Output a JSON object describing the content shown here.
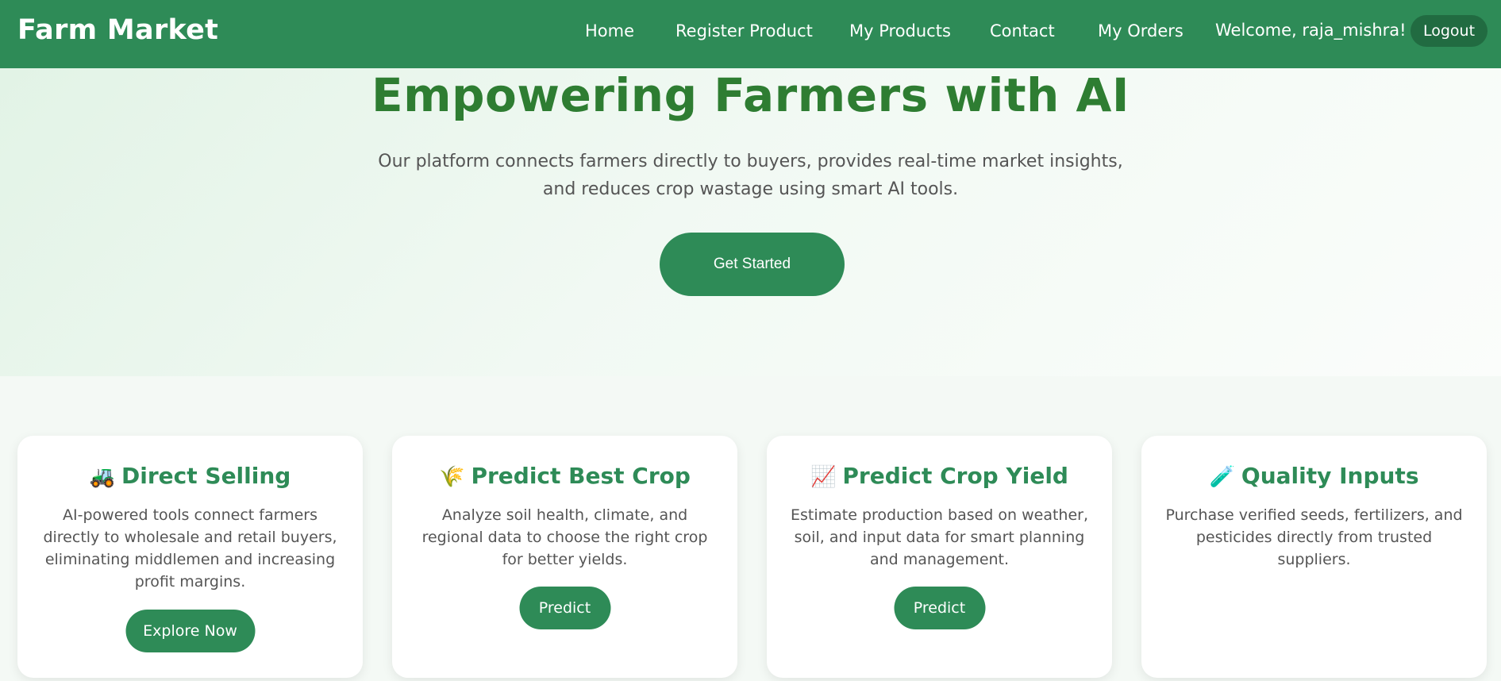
{
  "header": {
    "brand": "Farm Market",
    "nav": [
      "Home",
      "Register Product",
      "My Products",
      "Contact",
      "My Orders"
    ],
    "welcome": "Welcome, raja_mishra!",
    "logout": "Logout"
  },
  "hero": {
    "title": "Empowering Farmers with AI",
    "subtitle_line1": "Our platform connects farmers directly to buyers, provides real-time market insights,",
    "subtitle_line2": "and reduces crop wastage using smart AI tools.",
    "cta": "Get Started"
  },
  "features": [
    {
      "icon": "tractor-icon",
      "emoji": "🚜",
      "title": "Direct Selling",
      "description": "AI-powered tools connect farmers directly to wholesale and retail buyers, eliminating middlemen and increasing profit margins.",
      "button": "Explore Now"
    },
    {
      "icon": "wheat-icon",
      "emoji": "🌾",
      "title": "Predict Best Crop",
      "description": "Analyze soil health, climate, and regional data to choose the right crop for better yields.",
      "button": "Predict"
    },
    {
      "icon": "chart-increasing-icon",
      "emoji": "📈",
      "title": "Predict Crop Yield",
      "description": "Estimate production based on weather, soil, and input data for smart planning and management.",
      "button": "Predict"
    },
    {
      "icon": "test-tube-icon",
      "emoji": "🧪",
      "title": "Quality Inputs",
      "description": "Purchase verified seeds, fertilizers, and pesticides directly from trusted suppliers."
    }
  ],
  "colors": {
    "primary": "#2e8b57",
    "heading": "#2e7d32",
    "logout_bg": "#216b41"
  }
}
